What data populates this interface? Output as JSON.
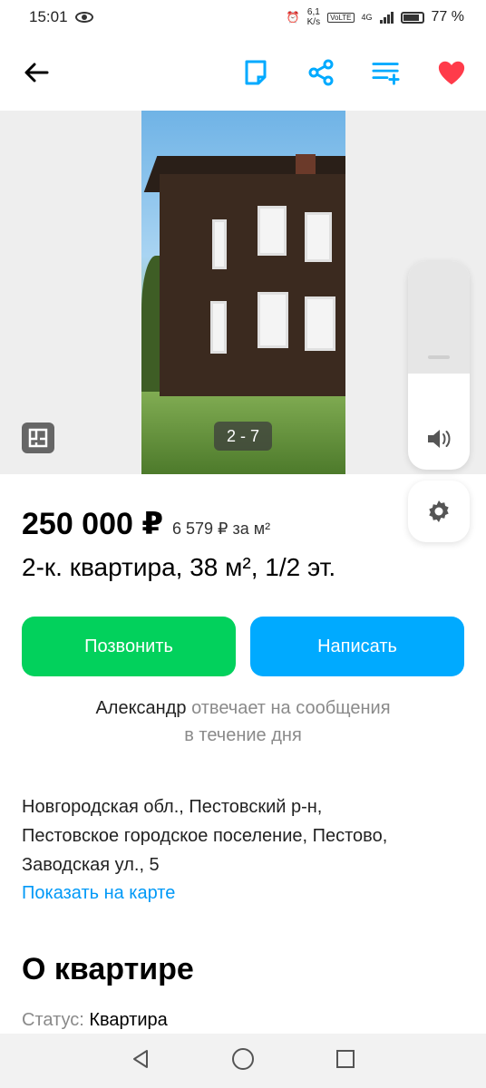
{
  "status_bar": {
    "time": "15:01",
    "speed_top": "6,1",
    "speed_bottom": "K/s",
    "volte": "VoLTE",
    "network": "4G",
    "battery": "77 %"
  },
  "toolbar": {
    "icons": [
      "back-arrow-icon",
      "note-icon",
      "share-icon",
      "compare-icon",
      "heart-icon"
    ],
    "favorite_color": "#ff3b4a",
    "accent_color": "#00aaff"
  },
  "gallery": {
    "counter": "2 - 7"
  },
  "volume": {
    "level": 0.4
  },
  "listing": {
    "price": "250 000 ₽",
    "price_per_m": "6 579 ₽ за м²",
    "title": "2-к. квартира, 38 м², 1/2 эт."
  },
  "actions": {
    "call_label": "Позвонить",
    "write_label": "Написать",
    "call_color": "#02d15c",
    "write_color": "#00aaff"
  },
  "seller": {
    "name": "Александр",
    "reply_rest": " отвечает на сообщения",
    "reply_line2": "в течение дня"
  },
  "location": {
    "line1": "Новгородская обл., Пестовский р-н,",
    "line2": "Пестовское городское поселение, Пестово,",
    "line3": "Заводская ул., 5",
    "map_link": "Показать на карте"
  },
  "about": {
    "title": "О квартире",
    "status_key": "Статус:",
    "status_value": "Квартира"
  }
}
